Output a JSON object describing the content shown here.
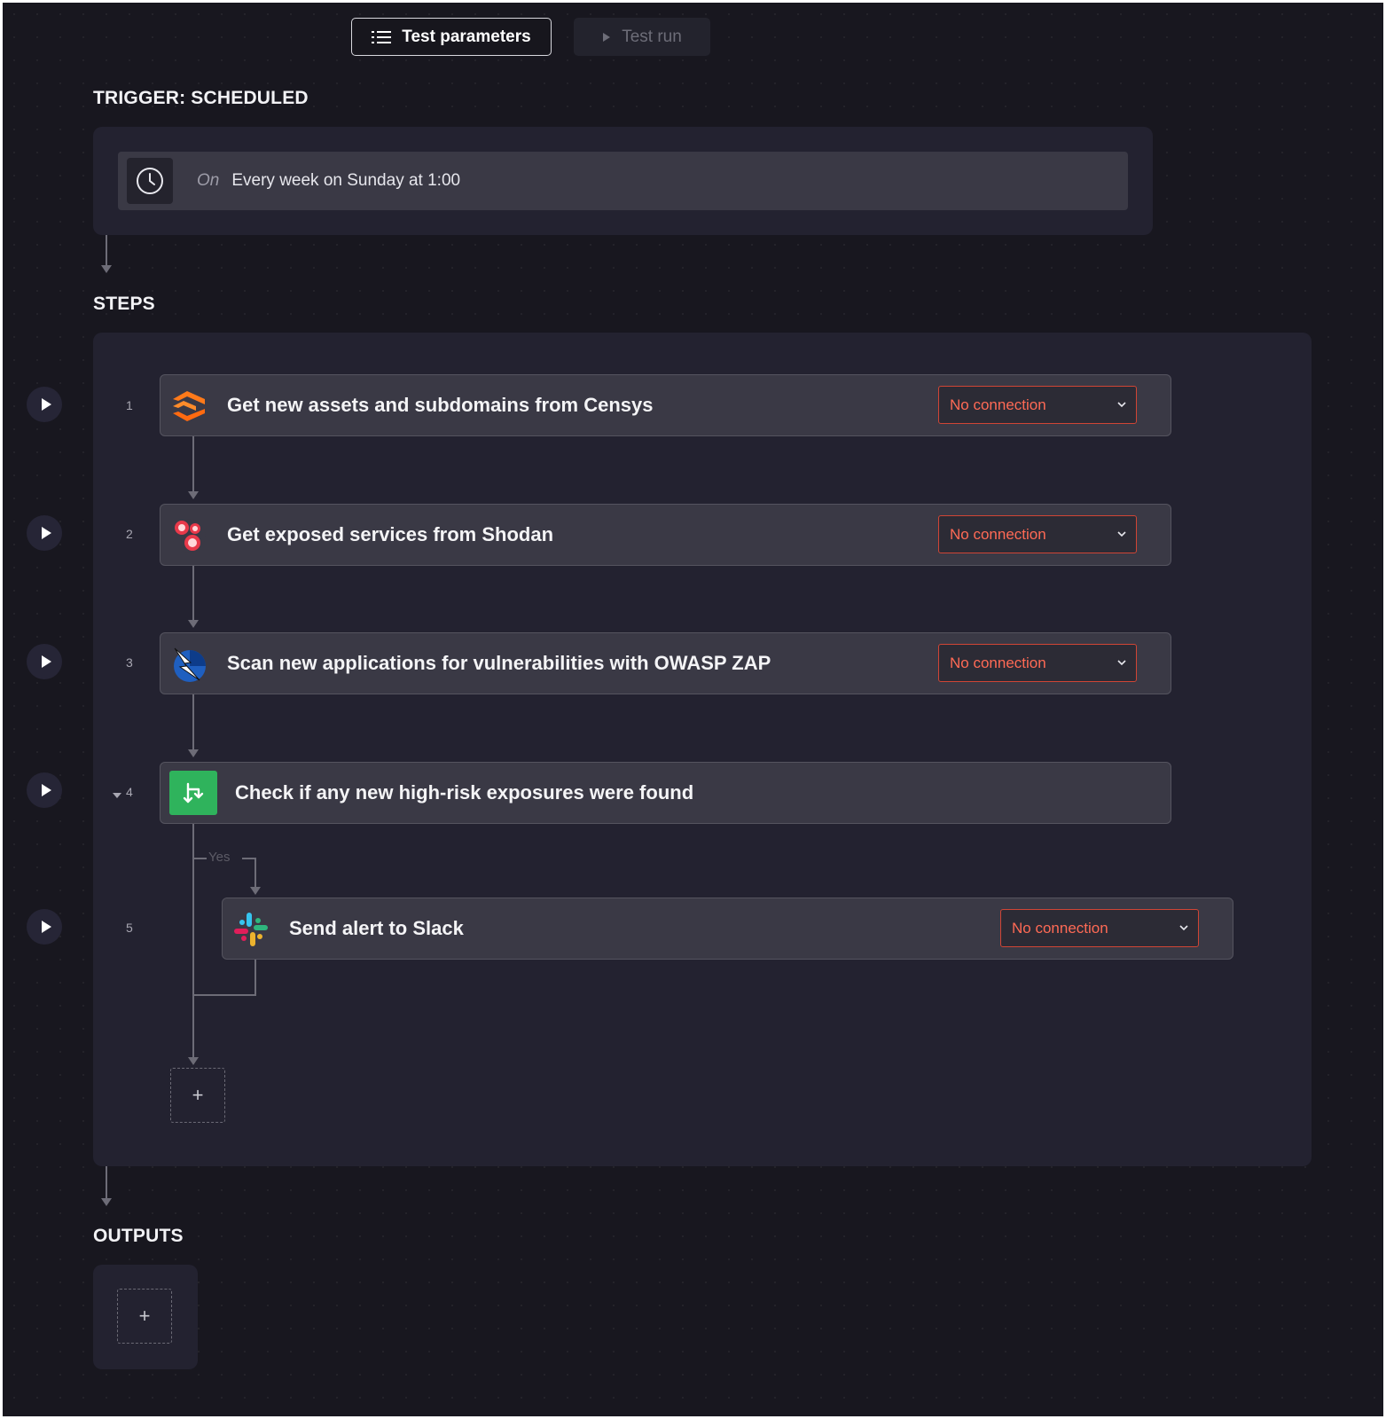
{
  "toolbar": {
    "test_parameters_label": "Test parameters",
    "test_run_label": "Test run"
  },
  "trigger": {
    "heading": "TRIGGER: SCHEDULED",
    "on_label": "On",
    "schedule": "Every week on Sunday at 1:00"
  },
  "steps": {
    "heading": "STEPS",
    "items": [
      {
        "number": "1",
        "title": "Get new assets and subdomains from Censys",
        "icon": "censys-icon",
        "connection": "No connection"
      },
      {
        "number": "2",
        "title": "Get exposed services from Shodan",
        "icon": "shodan-icon",
        "connection": "No connection"
      },
      {
        "number": "3",
        "title": "Scan new applications for vulnerabilities with OWASP ZAP",
        "icon": "owasp-zap-icon",
        "connection": "No connection"
      },
      {
        "number": "4",
        "title": "Check if any new high-risk exposures were found",
        "icon": "branch-icon"
      },
      {
        "number": "5",
        "title": "Send alert to Slack",
        "icon": "slack-icon",
        "connection": "No connection"
      }
    ],
    "branch_label": "Yes",
    "add_step_label": "+"
  },
  "outputs": {
    "heading": "OUTPUTS",
    "add_output_label": "+"
  },
  "colors": {
    "background": "#18171f",
    "panel": "#232230",
    "card": "#3a3945",
    "danger": "#ff6a55",
    "branch": "#2fb35c"
  }
}
